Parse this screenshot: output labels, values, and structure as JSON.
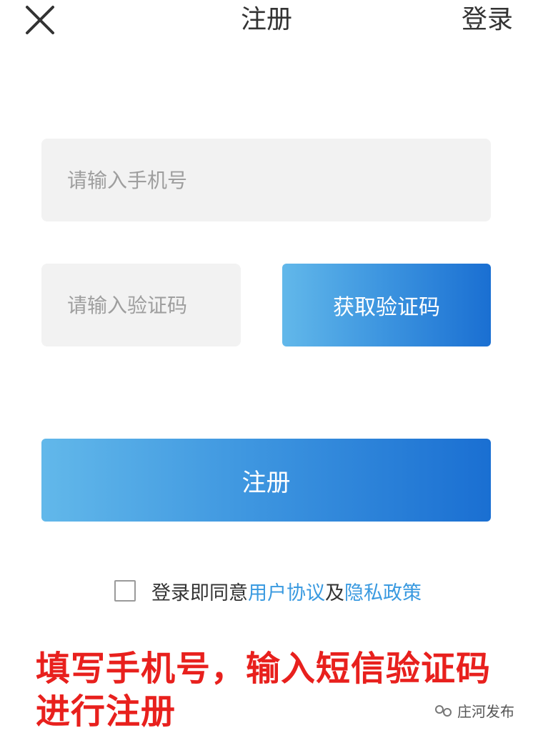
{
  "header": {
    "title": "注册",
    "login_label": "登录",
    "close_icon": "close-icon"
  },
  "form": {
    "phone_placeholder": "请输入手机号",
    "phone_value": "",
    "code_placeholder": "请输入验证码",
    "code_value": "",
    "get_code_label": "获取验证码",
    "register_label": "注册"
  },
  "agreement": {
    "checked": false,
    "prefix": "登录即同意",
    "user_agreement": "用户协议",
    "conjunction": "及",
    "privacy_policy": "隐私政策"
  },
  "annotation": {
    "line1": "填写手机号，输入短信验证码",
    "line2": "进行注册"
  },
  "watermark": {
    "icon": "wechat-channel-icon",
    "text": "庄河发布"
  },
  "colors": {
    "accent_start": "#62b8ea",
    "accent_end": "#1a6fd2",
    "link": "#3a9ae0",
    "annotation": "#e8201d",
    "field_bg": "#f2f2f2"
  }
}
